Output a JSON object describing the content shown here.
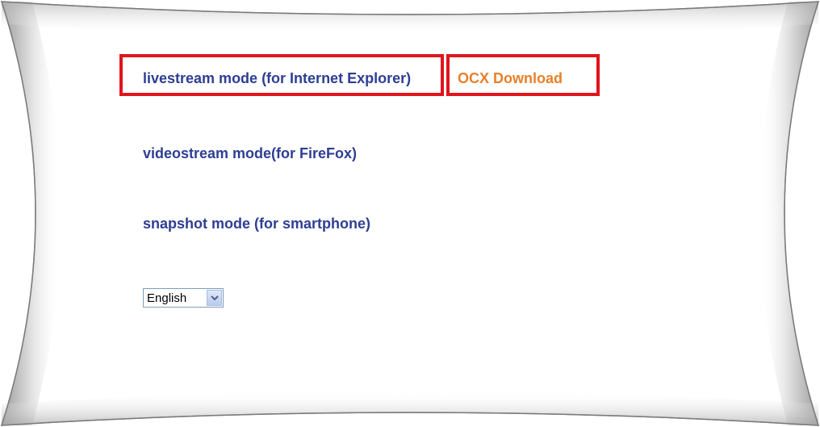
{
  "links": {
    "livestream_label": "livestream mode (for Internet Explorer)",
    "ocx_label": "OCX Download",
    "videostream_label": "videostream mode(for FireFox)",
    "snapshot_label": "snapshot mode (for smartphone)"
  },
  "language": {
    "selected": "English"
  },
  "colors": {
    "link_text": "#2d3e94",
    "ocx_text": "#e8802a",
    "highlight_border": "#e0141c",
    "background": "#ffffff"
  }
}
